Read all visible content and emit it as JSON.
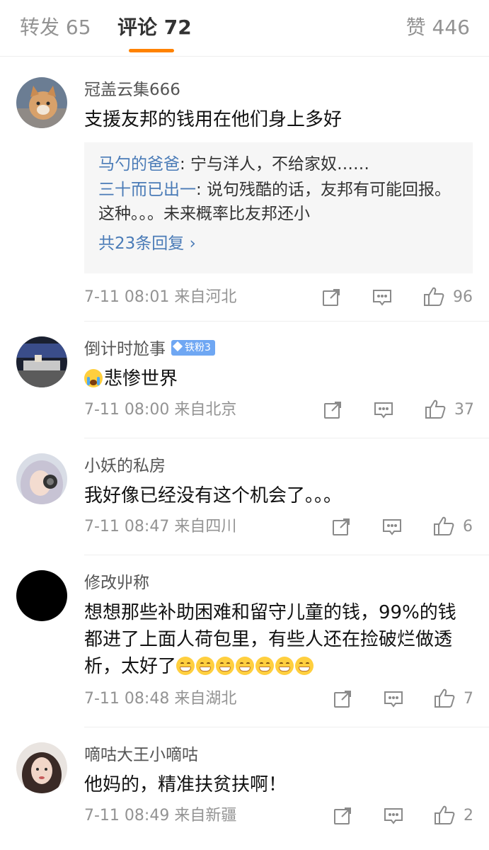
{
  "tabs": {
    "repost": "转发 65",
    "comments": "评论 72",
    "likes": "赞 446"
  },
  "accent_color": "#ff8200",
  "link_color": "#4a7bb7",
  "comments": [
    {
      "user": "冠盖云集666",
      "text": "支援友邦的钱用在他们身上多好",
      "replies": [
        {
          "name": "马勺的爸爸",
          "text": ": 宁与洋人，不给家奴……"
        },
        {
          "name": "三十而已出一",
          "text": ": 说句残酷的话，友邦有可能回报。这种。。。未来概率比友邦还小"
        }
      ],
      "more": "共23条回复 ›",
      "time": "7-11 08:01 来自河北",
      "likes": "96"
    },
    {
      "user": "倒计时尬事",
      "badge": "铁粉3",
      "text": "悲惨世界",
      "emoji": "crying-face",
      "time": "7-11 08:00 来自北京",
      "likes": "37"
    },
    {
      "user": "小妖的私房",
      "text": "我好像已经没有这个机会了。。。",
      "time": "7-11 08:47 来自四川",
      "likes": "6"
    },
    {
      "user": "修改丱称",
      "text": "想想那些补助困难和留守儿童的钱，99%的钱都进了上面人荷包里，有些人还在捡破烂做透析，太好了",
      "emoji": "grinning-face x7",
      "time": "7-11 08:48 来自湖北",
      "likes": "7"
    },
    {
      "user": "嘀咕大王小嘀咕",
      "text": "他妈的，精准扶贫扶啊！",
      "time": "7-11 08:49 来自新疆",
      "likes": "2"
    }
  ]
}
